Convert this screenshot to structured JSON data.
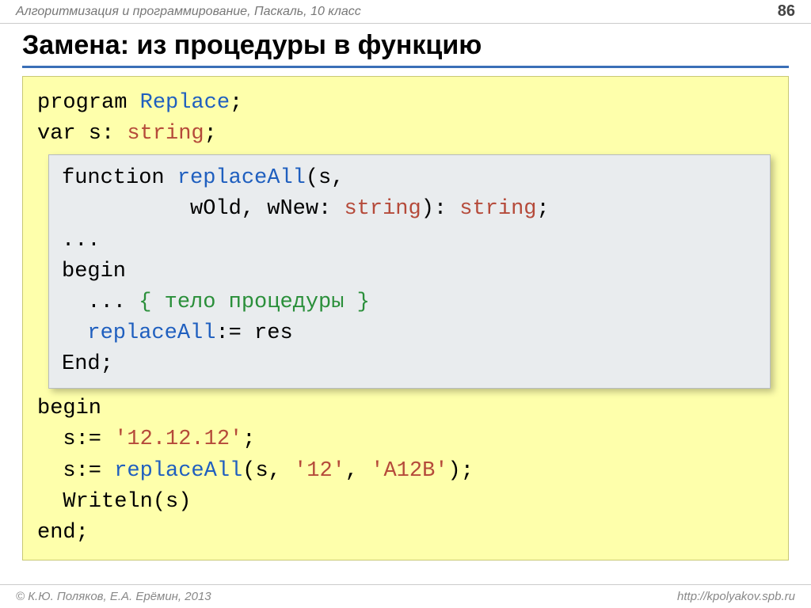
{
  "header": {
    "title": "Алгоритмизация и программирование, Паскаль, 10 класс",
    "page": "86"
  },
  "slide": {
    "title": "Замена: из процедуры в функцию"
  },
  "code": {
    "l1_a": "program ",
    "l1_b": "Replace",
    "l1_c": ";",
    "l2_a": "var s: ",
    "l2_b": "string",
    "l2_c": ";",
    "inner": {
      "l1_a": "function ",
      "l1_b": "replaceAll",
      "l1_c": "(s,",
      "l2_a": "          wOld, wNew: ",
      "l2_b": "string",
      "l2_c": "): ",
      "l2_d": "string",
      "l2_e": ";",
      "l3": "...",
      "l4": "begin",
      "l5_a": "  ... ",
      "l5_b": "{ тело процедуры }",
      "l6_a": "  ",
      "l6_b": "replaceAll",
      "l6_c": ":= res",
      "l7": "End;"
    },
    "l3": "begin",
    "l4_a": "  s:= ",
    "l4_b": "'12.12.12'",
    "l4_c": ";",
    "l5_a": "  s:= ",
    "l5_b": "replaceAll",
    "l5_c": "(s, ",
    "l5_d": "'12'",
    "l5_e": ", ",
    "l5_f": "'A12B'",
    "l5_g": ");",
    "l6": "  Writeln(s)",
    "l7": "end;"
  },
  "footer": {
    "left": "© К.Ю. Поляков, Е.А. Ерёмин, 2013",
    "right": "http://kpolyakov.spb.ru"
  }
}
